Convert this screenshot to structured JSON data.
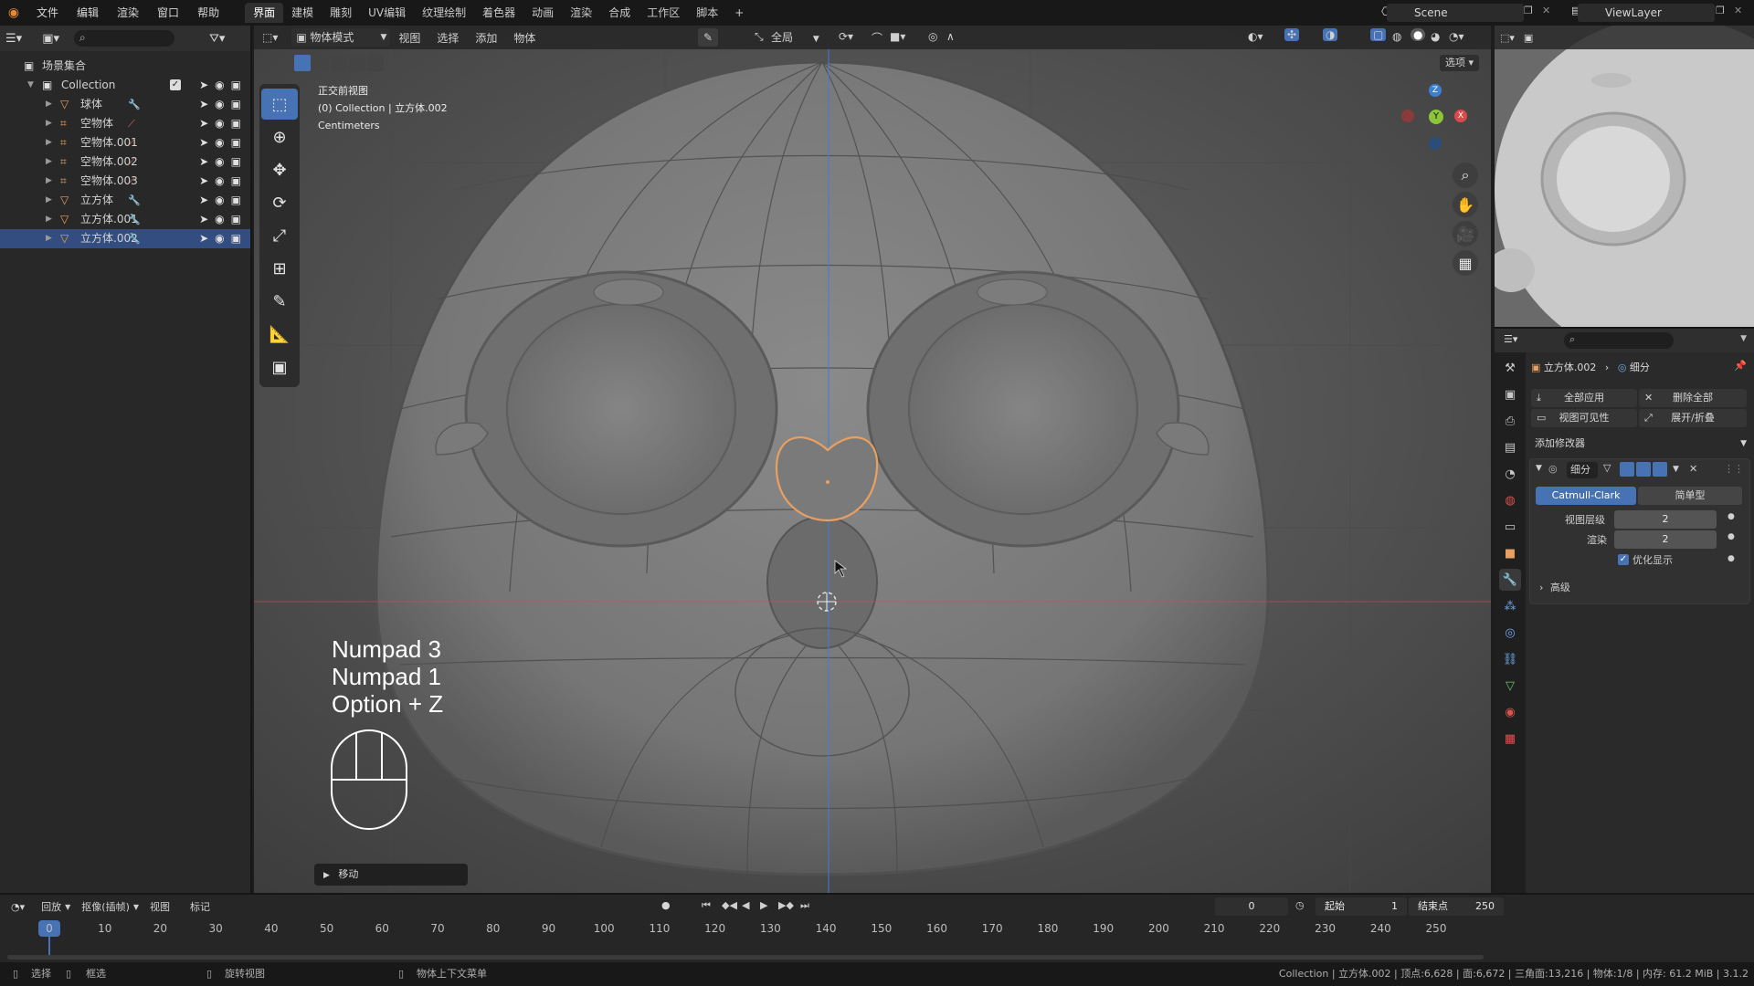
{
  "menu": [
    "文件",
    "编辑",
    "渲染",
    "窗口",
    "帮助"
  ],
  "workspaces": [
    "界面",
    "建模",
    "雕刻",
    "UV编辑",
    "纹理绘制",
    "着色器",
    "动画",
    "渲染",
    "合成",
    "工作区",
    "脚本"
  ],
  "active_workspace": "界面",
  "add_workspace": "+",
  "scene_name": "Scene",
  "view_layer_name": "ViewLayer",
  "outliner": {
    "root_label": "场景集合",
    "collection_label": "Collection",
    "items": [
      {
        "label": "球体",
        "type": "mesh",
        "selected": false
      },
      {
        "label": "空物体",
        "type": "empty",
        "selected": false
      },
      {
        "label": "空物体.001",
        "type": "empty",
        "selected": false
      },
      {
        "label": "空物体.002",
        "type": "empty",
        "selected": false
      },
      {
        "label": "空物体.003",
        "type": "empty",
        "selected": false
      },
      {
        "label": "立方体",
        "type": "mesh",
        "selected": false
      },
      {
        "label": "立方体.001",
        "type": "mesh",
        "selected": false
      },
      {
        "label": "立方体.002",
        "type": "mesh",
        "selected": true
      }
    ]
  },
  "viewport": {
    "mode": "物体模式",
    "menus": [
      "视图",
      "选择",
      "添加",
      "物体"
    ],
    "transform_orientation": "全局",
    "options_label": "选项",
    "view_name": "正交前视图",
    "context": "(0) Collection | 立方体.002",
    "units": "Centimeters",
    "keys": [
      "Numpad 3",
      "Numpad 1",
      "Option + Z"
    ],
    "last_operator": "移动",
    "gizmo": {
      "z": "Z",
      "y": "Y",
      "x": "X"
    }
  },
  "properties": {
    "object_name": "立方体.002",
    "modifier_tab_label": "细分",
    "apply_all": "全部应用",
    "delete_all": "删除全部",
    "viewport_vis": "视图可见性",
    "expand_collapse": "展开/折叠",
    "add_modifier": "添加修改器",
    "modifier_name": "细分",
    "catmull_clark": "Catmull-Clark",
    "simple": "简单型",
    "levels_viewport_label": "视图层级",
    "levels_viewport": "2",
    "render_label": "渲染",
    "render_levels": "2",
    "optimal_display": "优化显示",
    "optimal_display_checked": true,
    "advanced": "高级"
  },
  "timeline": {
    "menus": [
      "回放",
      "抠像(插帧)",
      "视图",
      "标记"
    ],
    "current_frame": "0",
    "start_label": "起始",
    "start": "1",
    "end_label": "结束点",
    "end": "250",
    "ticks": [
      0,
      10,
      20,
      30,
      40,
      50,
      60,
      70,
      80,
      90,
      100,
      110,
      120,
      130,
      140,
      150,
      160,
      170,
      180,
      190,
      200,
      210,
      220,
      230,
      240,
      250
    ],
    "playhead_frame": 0
  },
  "status": {
    "select": "选择",
    "box_select": "框选",
    "rotate_view": "旋转视图",
    "context_menu": "物体上下文菜单",
    "stats": "Collection | 立方体.002 | 顶点:6,628 | 面:6,672 | 三角面:13,216 | 物体:1/8 | 内存: 61.2 MiB | 3.1.2"
  },
  "colors": {
    "accent": "#4772b3",
    "selection_row": "#334d80",
    "outline": "#e8a060",
    "axis_x": "#d94a4a",
    "axis_y": "#8cc43a",
    "axis_z": "#3e7fd6"
  }
}
